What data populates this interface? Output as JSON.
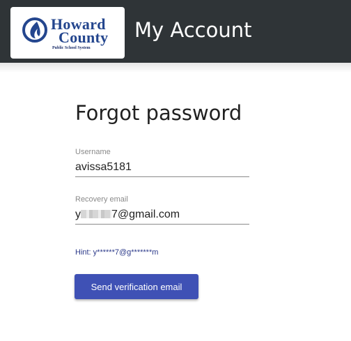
{
  "header": {
    "logo": {
      "line1": "Howard",
      "line2": "County",
      "subline": "Public School System",
      "icon": "flame-icon"
    },
    "title": "My Account"
  },
  "form": {
    "title": "Forgot password",
    "username": {
      "label": "Username",
      "value": "avissa5181"
    },
    "recovery_email": {
      "label": "Recovery email",
      "value_start": "y",
      "value_end": "7@gmail.com"
    },
    "hint": "Hint: y******7@g*******m",
    "submit_label": "Send verification email"
  },
  "colors": {
    "header_bg": "#2f3437",
    "logo_blue": "#24468e",
    "button_bg": "#3f51b5",
    "hint_text": "#2c3a8a"
  }
}
